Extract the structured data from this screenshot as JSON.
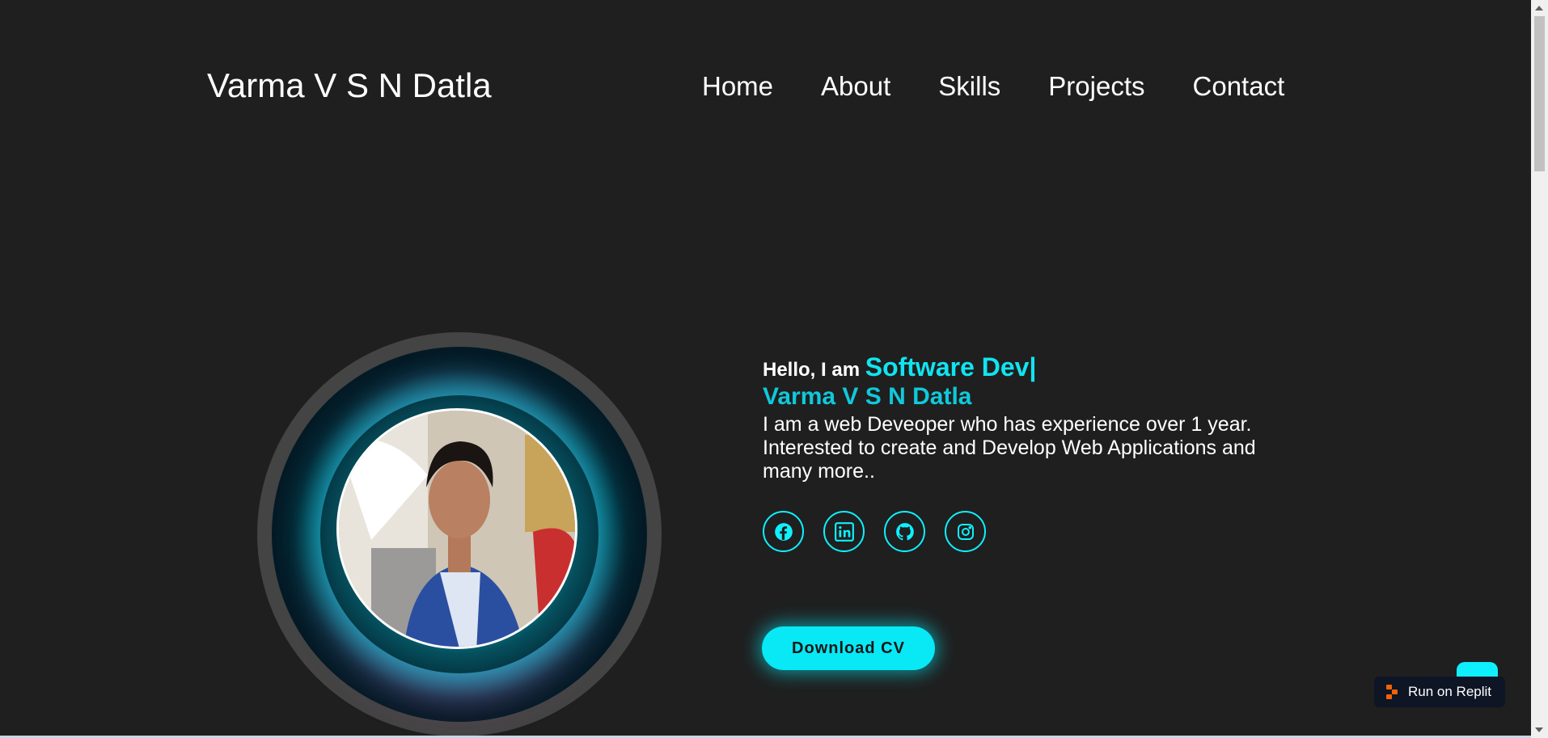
{
  "header": {
    "brand": "Varma V S N Datla",
    "nav": [
      "Home",
      "About",
      "Skills",
      "Projects",
      "Contact"
    ]
  },
  "hero": {
    "greeting": "Hello, I am",
    "role": "Software Dev|",
    "name": "Varma V S N Datla",
    "description": "I am a web Deveoper who has experience over 1 year. Interested to create and Develop Web Applications and many more..",
    "socials": [
      {
        "icon": "facebook-icon"
      },
      {
        "icon": "linkedin-icon"
      },
      {
        "icon": "github-icon"
      },
      {
        "icon": "instagram-icon"
      }
    ],
    "cta": "Download CV"
  },
  "replit": {
    "label": "Run on Replit"
  },
  "colors": {
    "background": "#1f1f1f",
    "accent": "#10e4f0",
    "ring": "#444444"
  }
}
